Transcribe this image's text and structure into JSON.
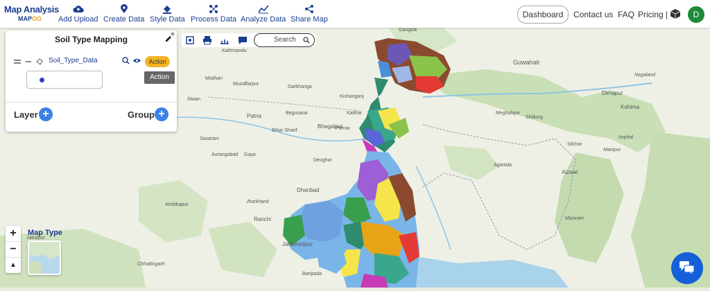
{
  "brand": {
    "title": "Map Analysis",
    "sub_a": "MAP",
    "sub_b": "OG"
  },
  "toolbar": [
    {
      "label": "Add Upload",
      "icon": "cloud-upload-icon"
    },
    {
      "label": "Create Data",
      "icon": "map-pin-icon"
    },
    {
      "label": "Style Data",
      "icon": "paint-bucket-icon"
    },
    {
      "label": "Process Data",
      "icon": "process-nodes-icon"
    },
    {
      "label": "Analyze Data",
      "icon": "analyze-chart-icon"
    },
    {
      "label": "Share Map",
      "icon": "share-icon"
    }
  ],
  "nav": {
    "dashboard": "Dashboard",
    "contact": "Contact us",
    "faq": "FAQ",
    "pricing": "Pricing |",
    "avatar_initial": "D"
  },
  "panel": {
    "title": "Soil Type Mapping",
    "layer_name": "Soil_Type_Data",
    "action_label": "Action",
    "tooltip": "Action",
    "layer_label": "Layer",
    "group_label": "Group"
  },
  "map_tools": {
    "search_placeholder": "Search"
  },
  "map_type_label": "Map Type",
  "map_labels": [
    "Gangtok",
    "Guwahati",
    "Dimapur",
    "Kohima",
    "Meghalaya",
    "Nagaland",
    "Shillong",
    "Silchar",
    "Manipur",
    "Imphal",
    "Aizawl",
    "Mizoram",
    "Agartala",
    "Kathmandu",
    "Muzaffarpur",
    "Darbhanga",
    "Motihari",
    "Siwan",
    "Patna",
    "Begusarai",
    "Bhagalpur",
    "Bihar Sharif",
    "Sasaram",
    "Gaya",
    "Aurangabad",
    "Deoghar",
    "Dhanbad",
    "Ranchi",
    "Jharkhand",
    "Jamshedpur",
    "Ambikapur",
    "Jabalpur",
    "Chhattisgarh",
    "Baripada",
    "Kishanganj",
    "Katihar",
    "Purnia"
  ],
  "colors": {
    "brand": "#1a3d8f",
    "accent": "#f5b324",
    "primary_btn": "#3b82e6",
    "avatar": "#1e8a3a"
  }
}
